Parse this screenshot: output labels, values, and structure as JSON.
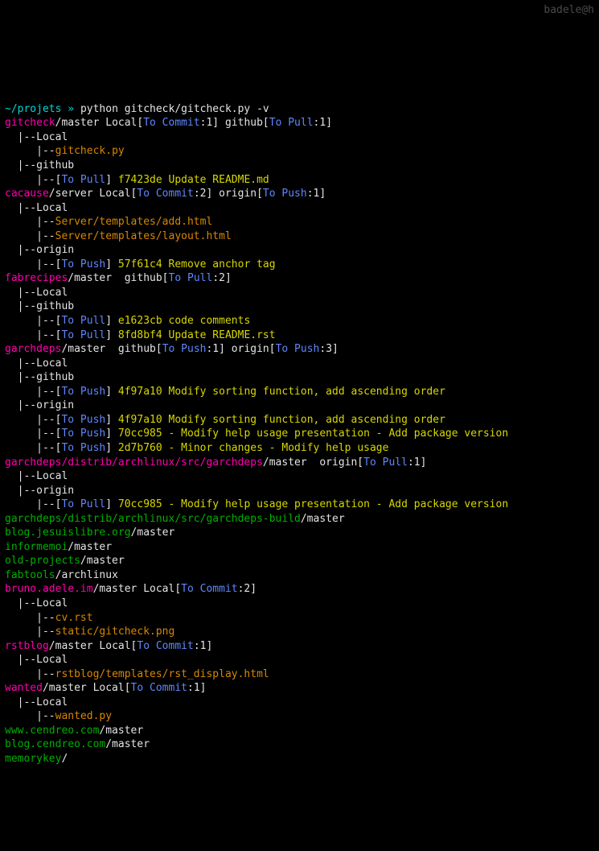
{
  "prompt": {
    "cwd": "~/projets",
    "sep": "»",
    "cmd": "python gitcheck/gitcheck.py -v"
  },
  "userhost": "badele@h",
  "lines": [
    [
      [
        "magenta",
        "gitcheck"
      ],
      [
        "white",
        "/master Local["
      ],
      [
        "blue",
        "To Commit"
      ],
      [
        "white",
        ":1] github["
      ],
      [
        "blue",
        "To Pull"
      ],
      [
        "white",
        ":1]"
      ]
    ],
    [
      [
        "white",
        "  |--Local"
      ]
    ],
    [
      [
        "white",
        "     |--"
      ],
      [
        "orange",
        "gitcheck.py"
      ]
    ],
    [
      [
        "white",
        "  |--github"
      ]
    ],
    [
      [
        "white",
        "     |--["
      ],
      [
        "blue",
        "To Pull"
      ],
      [
        "white",
        "] "
      ],
      [
        "yellow",
        "f7423de Update README.md"
      ]
    ],
    [
      [
        "magenta",
        "cacause"
      ],
      [
        "white",
        "/server Local["
      ],
      [
        "blue",
        "To Commit"
      ],
      [
        "white",
        ":2] origin["
      ],
      [
        "blue",
        "To Push"
      ],
      [
        "white",
        ":1]"
      ]
    ],
    [
      [
        "white",
        "  |--Local"
      ]
    ],
    [
      [
        "white",
        "     |--"
      ],
      [
        "orange",
        "Server/templates/add.html"
      ]
    ],
    [
      [
        "white",
        "     |--"
      ],
      [
        "orange",
        "Server/templates/layout.html"
      ]
    ],
    [
      [
        "white",
        "  |--origin"
      ]
    ],
    [
      [
        "white",
        "     |--["
      ],
      [
        "blue",
        "To Push"
      ],
      [
        "white",
        "] "
      ],
      [
        "yellow",
        "57f61c4 Remove anchor tag"
      ]
    ],
    [
      [
        "magenta",
        "fabrecipes"
      ],
      [
        "white",
        "/master  github["
      ],
      [
        "blue",
        "To Pull"
      ],
      [
        "white",
        ":2]"
      ]
    ],
    [
      [
        "white",
        "  |--Local"
      ]
    ],
    [
      [
        "white",
        "  |--github"
      ]
    ],
    [
      [
        "white",
        "     |--["
      ],
      [
        "blue",
        "To Pull"
      ],
      [
        "white",
        "] "
      ],
      [
        "yellow",
        "e1623cb code comments"
      ]
    ],
    [
      [
        "white",
        "     |--["
      ],
      [
        "blue",
        "To Pull"
      ],
      [
        "white",
        "] "
      ],
      [
        "yellow",
        "8fd8bf4 Update README.rst"
      ]
    ],
    [
      [
        "magenta",
        "garchdeps"
      ],
      [
        "white",
        "/master  github["
      ],
      [
        "blue",
        "To Push"
      ],
      [
        "white",
        ":1] origin["
      ],
      [
        "blue",
        "To Push"
      ],
      [
        "white",
        ":3]"
      ]
    ],
    [
      [
        "white",
        "  |--Local"
      ]
    ],
    [
      [
        "white",
        "  |--github"
      ]
    ],
    [
      [
        "white",
        "     |--["
      ],
      [
        "blue",
        "To Push"
      ],
      [
        "white",
        "] "
      ],
      [
        "yellow",
        "4f97a10 Modify sorting function, add ascending order"
      ]
    ],
    [
      [
        "white",
        "  |--origin"
      ]
    ],
    [
      [
        "white",
        "     |--["
      ],
      [
        "blue",
        "To Push"
      ],
      [
        "white",
        "] "
      ],
      [
        "yellow",
        "4f97a10 Modify sorting function, add ascending order"
      ]
    ],
    [
      [
        "white",
        "     |--["
      ],
      [
        "blue",
        "To Push"
      ],
      [
        "white",
        "] "
      ],
      [
        "yellow",
        "70cc985 - Modify help usage presentation - Add package version"
      ]
    ],
    [
      [
        "white",
        "     |--["
      ],
      [
        "blue",
        "To Push"
      ],
      [
        "white",
        "] "
      ],
      [
        "yellow",
        "2d7b760 - Minor changes - Modify help usage"
      ]
    ],
    [
      [
        "magenta",
        "garchdeps/distrib/archlinux/src/garchdeps"
      ],
      [
        "white",
        "/master  origin["
      ],
      [
        "blue",
        "To Pull"
      ],
      [
        "white",
        ":1]"
      ]
    ],
    [
      [
        "white",
        "  |--Local"
      ]
    ],
    [
      [
        "white",
        "  |--origin"
      ]
    ],
    [
      [
        "white",
        "     |--["
      ],
      [
        "blue",
        "To Pull"
      ],
      [
        "white",
        "] "
      ],
      [
        "yellow",
        "70cc985 - Modify help usage presentation - Add package version"
      ]
    ],
    [
      [
        "green",
        "garchdeps/distrib/archlinux/src/garchdeps-build"
      ],
      [
        "white",
        "/master"
      ]
    ],
    [
      [
        "green",
        "blog.jesuislibre.org"
      ],
      [
        "white",
        "/master"
      ]
    ],
    [
      [
        "green",
        "informemoi"
      ],
      [
        "white",
        "/master"
      ]
    ],
    [
      [
        "green",
        "old-projects"
      ],
      [
        "white",
        "/master"
      ]
    ],
    [
      [
        "green",
        "fabtools"
      ],
      [
        "white",
        "/archlinux"
      ]
    ],
    [
      [
        "magenta",
        "bruno.adele.im"
      ],
      [
        "white",
        "/master Local["
      ],
      [
        "blue",
        "To Commit"
      ],
      [
        "white",
        ":2]"
      ]
    ],
    [
      [
        "white",
        "  |--Local"
      ]
    ],
    [
      [
        "white",
        "     |--"
      ],
      [
        "orange",
        "cv.rst"
      ]
    ],
    [
      [
        "white",
        "     |--"
      ],
      [
        "orange",
        "static/gitcheck.png"
      ]
    ],
    [
      [
        "magenta",
        "rstblog"
      ],
      [
        "white",
        "/master Local["
      ],
      [
        "blue",
        "To Commit"
      ],
      [
        "white",
        ":1]"
      ]
    ],
    [
      [
        "white",
        "  |--Local"
      ]
    ],
    [
      [
        "white",
        "     |--"
      ],
      [
        "orange",
        "rstblog/templates/rst_display.html"
      ]
    ],
    [
      [
        "magenta",
        "wanted"
      ],
      [
        "white",
        "/master Local["
      ],
      [
        "blue",
        "To Commit"
      ],
      [
        "white",
        ":1]"
      ]
    ],
    [
      [
        "white",
        "  |--Local"
      ]
    ],
    [
      [
        "white",
        "     |--"
      ],
      [
        "orange",
        "wanted.py"
      ]
    ],
    [
      [
        "green",
        "www.cendreo.com"
      ],
      [
        "white",
        "/master"
      ]
    ],
    [
      [
        "green",
        "blog.cendreo.com"
      ],
      [
        "white",
        "/master"
      ]
    ],
    [
      [
        "green",
        "memorykey"
      ],
      [
        "white",
        "/"
      ]
    ]
  ]
}
